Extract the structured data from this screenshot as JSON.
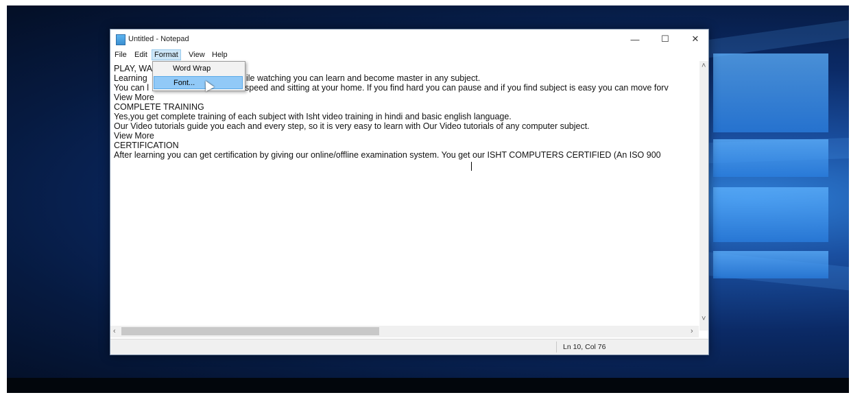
{
  "window": {
    "title": "Untitled - Notepad",
    "minimize": "—",
    "maximize": "☐",
    "close": "✕"
  },
  "menu": {
    "file": "File",
    "edit": "Edit",
    "format": "Format",
    "view": "View",
    "help": "Help"
  },
  "format_menu": {
    "word_wrap": "Word Wrap",
    "font": "Font..."
  },
  "document": {
    "lines": [
      "PLAY, WA",
      "Learning",
      "You can l",
      "View More",
      "COMPLETE TRAINING",
      "Yes,you get complete training of each subject with Isht video training in hindi and basic english language.",
      "Our Video tutorials guide you each and every step, so it is very easy to learn with Our Video tutorials of any computer subject.",
      "View More",
      "CERTIFICATION",
      "After learning you can get certification by giving our online/offline examination system. You get our ISHT COMPUTERS CERTIFIED (An ISO 900"
    ],
    "line2_tail": "ile watching you can learn and become master in any subject.",
    "line3_tail": "speed and sitting at your home. If you find hard you can pause and if you find subject is easy you can move forv"
  },
  "statusbar": {
    "position": "Ln 10, Col 76"
  },
  "colors": {
    "menu_highlight": "#cde6f7",
    "dropdown_hover": "#91c9f7",
    "desktop_blue": "#1a4fa0"
  }
}
